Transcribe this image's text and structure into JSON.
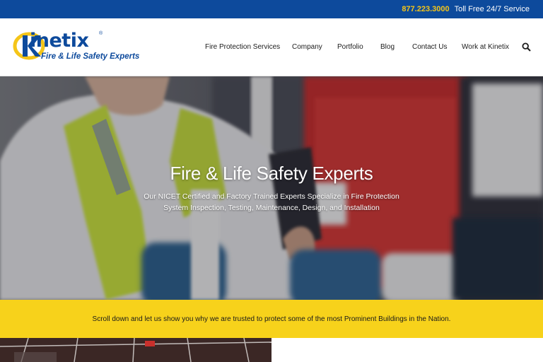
{
  "topbar": {
    "phone": "877.223.3000",
    "tollfree": "Toll Free 24/7 Service",
    "colors": {
      "background": "#0d4a9c",
      "phone": "#f5c518"
    }
  },
  "logo": {
    "wordmark": "inetix",
    "registered": "®",
    "tagline": "Fire & Life Safety Experts",
    "icon": "kinetix-k-logo-icon",
    "colors": {
      "blue": "#0d4a9c",
      "yellow": "#f5c518"
    }
  },
  "nav": {
    "items": [
      {
        "label": "Fire Protection Services"
      },
      {
        "label": "Company"
      },
      {
        "label": "Portfolio"
      },
      {
        "label": "Blog"
      },
      {
        "label": "Contact Us"
      },
      {
        "label": "Work at Kinetix"
      }
    ],
    "search_icon": "search-icon"
  },
  "hero": {
    "title": "Fire & Life Safety Experts",
    "subtitle_line1": "Our NICET Certified and Factory Trained Experts Specialize in Fire Protection",
    "subtitle_line2": "System Inspection, Testing, Maintenance, Design, and Installation"
  },
  "banner": {
    "text": "Scroll down and let us show you why we are trusted to protect some of the most Prominent Buildings in the Nation.",
    "color": "#f7d21b"
  }
}
